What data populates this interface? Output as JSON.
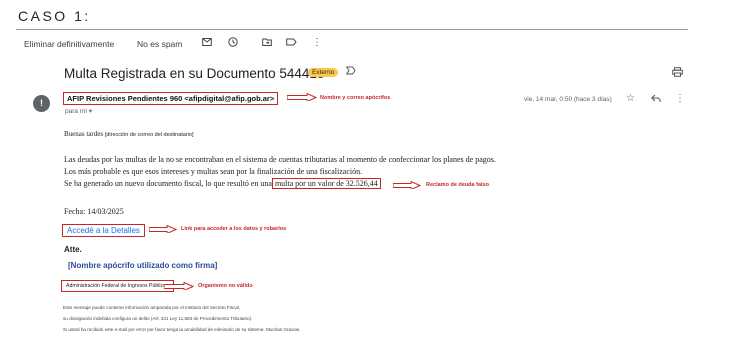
{
  "header": {
    "case_title": "CASO 1:"
  },
  "toolbar": {
    "delete_label": "Eliminar definitivamente",
    "spam_label": "No es spam",
    "icons": [
      "mail-icon",
      "clock-icon",
      "move-to-icon",
      "label-icon",
      "more-vert-icon"
    ]
  },
  "email": {
    "subject": "Multa Registrada en su Documento 544418",
    "badge": "Externo",
    "sender": "AFIP Revisiones Pendientes 960 <afipdigital@afip.gob.ar>",
    "recipient": "para mí ▾",
    "date": "vie, 14 mar, 0:50 (hace 3 días)",
    "greeting": "Buenas tardes",
    "recipient_placeholder": "[dirección de correo del destinatario]",
    "body_line1": "Las deudas por las multas de la no se encontraban en el sistema de cuentas tributarias al momento de confeccionar los planes de pagos.",
    "body_line2": "Los más probable es que esos intereses y multas sean por la finalización de una fiscalización.",
    "body_line3_prefix": "Se ha generado un nuevo documento fiscal, lo que resultó en una",
    "debt_text": "multa por un valor de 32.526,44",
    "date_line": "Fecha: 14/03/2025",
    "link_text": "Accedé a la Detalles",
    "signoff": "Atte.",
    "fake_name": "[Nombre apócrifo utilizado como firma]",
    "organization": "Administración Federal de Ingresos Públicos",
    "disclaimer1": "Este mensaje puede contener información amparada por el Instituto del Secreto Fiscal,",
    "disclaimer2": "su divulgación indebida configura un delito (Art. 101 Ley 11.683 de Procedimiento Tributario).",
    "disclaimer3": "Si usted ha recibido este e-mail por error por favor tenga la amabilidad de eliminarlo de su sistema. Muchas Gracias."
  },
  "annotations": {
    "sender": "Nombre y correo apócrifos",
    "debt": "Reclamo de deuda falso",
    "link": "Link para acceder a los datos y robarlos",
    "organization": "Organismo no válido"
  },
  "colors": {
    "annotation": "#c62828",
    "link": "#1a73e8",
    "badge": "#f9c74f"
  }
}
